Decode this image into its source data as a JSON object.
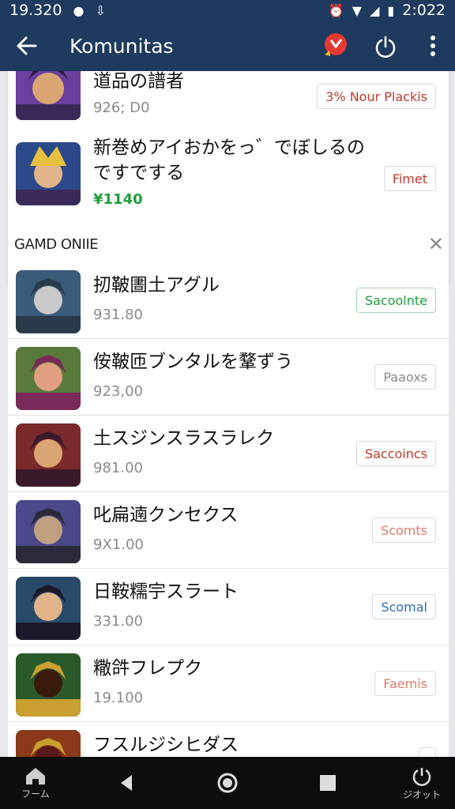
{
  "status_bar": {
    "left_text": "19.320",
    "time": "2:022"
  },
  "app_bar": {
    "title": "Komunitas"
  },
  "featured": [
    {
      "title": "道品の譜者",
      "subtitle": "926; D0",
      "tag": "3% Nour Plackis",
      "tag_color": "#c0392b"
    },
    {
      "title_line1": "新巻めアイおかをっ゛でぼしるの",
      "title_line2": "ですでする",
      "price": "¥1140",
      "tag": "Fimet",
      "tag_color": "#c0392b"
    }
  ],
  "section": {
    "label": "GAMD ONIIE"
  },
  "games": [
    {
      "title": "扨鞁圕土アグル",
      "subtitle": "931.80",
      "tag": "Sacoolnte",
      "tag_color": "#1e9d3a"
    },
    {
      "title": "侒鞁匝ブンタルを鞪ずう",
      "subtitle": "923,00",
      "tag": "Paaoxs",
      "tag_color": "#8a8a8a"
    },
    {
      "title": "土スジンスラスラレク",
      "subtitle": "981.00",
      "tag": "Saccoincs",
      "tag_color": "#c0392b"
    },
    {
      "title": "叱扁遖クンセクス",
      "subtitle": "9X1.00",
      "tag": "Scomts",
      "tag_color": "#e07a6a"
    },
    {
      "title": "日鞍糯𡧃スラート",
      "subtitle": "331.00",
      "tag": "Scomal",
      "tag_color": "#2a6fb0"
    },
    {
      "title": "糤𤙖フレプク",
      "subtitle": "19.100",
      "tag": "Faemis",
      "tag_color": "#e07a6a"
    },
    {
      "title": "フスルジシヒダス",
      "subtitle": "",
      "tag": "",
      "tag_color": "#8a8a8a"
    }
  ],
  "nav_bar": {
    "home_label": "フーム",
    "power_label": "ジオット"
  }
}
